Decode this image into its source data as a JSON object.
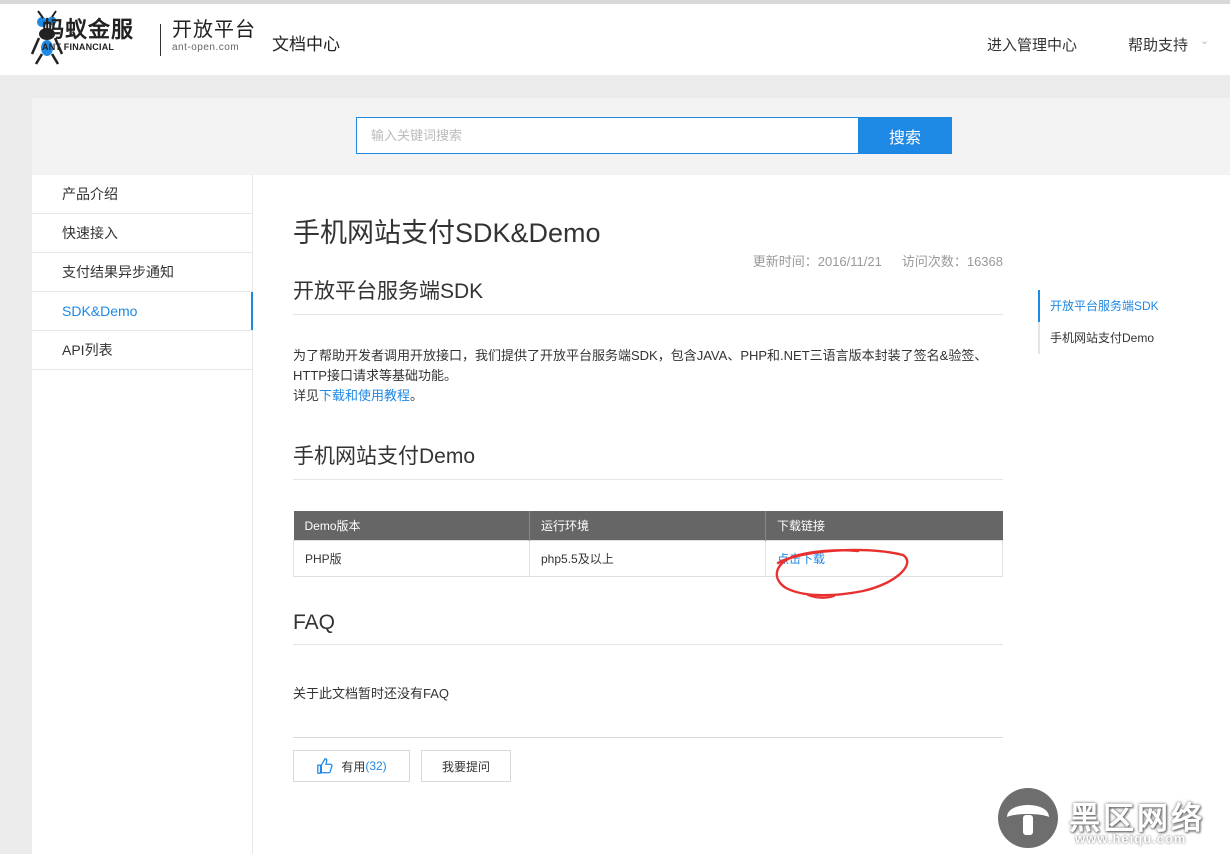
{
  "header": {
    "logo_cn": "蚂蚁金服",
    "logo_en": "ANT FINANCIAL",
    "platform_cn": "开放平台",
    "platform_en": "ant-open.com",
    "doc_center": "文档中心",
    "nav_manage": "进入管理中心",
    "nav_help": "帮助支持"
  },
  "search": {
    "placeholder": "输入关键词搜索",
    "button": "搜索"
  },
  "sidebar": {
    "items": [
      {
        "label": "产品介绍"
      },
      {
        "label": "快速接入"
      },
      {
        "label": "支付结果异步通知"
      },
      {
        "label": "SDK&Demo"
      },
      {
        "label": "API列表"
      }
    ]
  },
  "content": {
    "title": "手机网站支付SDK&Demo",
    "updated": "更新时间：2016/11/21",
    "visits": "访问次数：16368",
    "section1_title": "开放平台服务端SDK",
    "section1_text": "为了帮助开发者调用开放接口，我们提供了开放平台服务端SDK，包含JAVA、PHP和.NET三语言版本封装了签名&验签、HTTP接口请求等基础功能。",
    "section1_see": "详见",
    "section1_link": "下载和使用教程",
    "section1_end": "。",
    "section2_title": "手机网站支付Demo",
    "table": {
      "headers": [
        "Demo版本",
        "运行环境",
        "下载链接"
      ],
      "rows": [
        {
          "version": "PHP版",
          "env": "php5.5及以上",
          "link": "点击下载"
        }
      ]
    },
    "faq_title": "FAQ",
    "faq_text": "关于此文档暂时还没有FAQ",
    "useful_label": "有用",
    "useful_count": "(32)",
    "ask_label": "我要提问"
  },
  "toc": {
    "items": [
      {
        "label": "开放平台服务端SDK"
      },
      {
        "label": "手机网站支付Demo"
      }
    ]
  },
  "watermark": {
    "text": "黑区网络",
    "url": "www.heiqu.com"
  },
  "colors": {
    "accent": "#1e88e5",
    "table_header": "#666666",
    "annotation": "#e8312f"
  }
}
